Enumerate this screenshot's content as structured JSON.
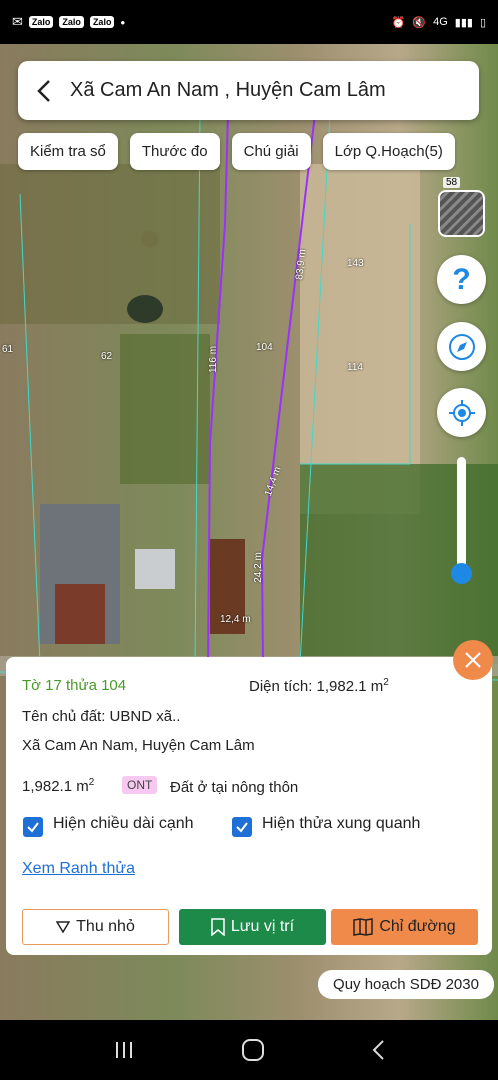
{
  "status": {
    "left_chips": [
      "Zalo",
      "Zalo",
      "Zalo"
    ],
    "network": "4G"
  },
  "header": {
    "title": "Xã Cam An Nam , Huyện Cam Lâm"
  },
  "toolbar": {
    "chips": [
      "Kiểm tra sổ",
      "Thước đo",
      "Chú giải",
      "Lớp Q.Hoạch(5)"
    ]
  },
  "map": {
    "side_badge": "58",
    "parcel_labels": [
      "143",
      "104",
      "114",
      "62",
      "61"
    ],
    "edge_labels": [
      "83,9 m",
      "116 m",
      "14,4 m",
      "24,2 m",
      "12,4 m"
    ],
    "selected_outline_color": "#9b30ff",
    "boundary_color": "#46d7c8"
  },
  "card": {
    "parcel": "Tờ 17 thửa 104",
    "area_label": "Diện tích: 1,982.1 m",
    "area_sup": "2",
    "owner": "Tên chủ đất: UBND xã..",
    "location": "Xã Cam An Nam, Huyện Cam Lâm",
    "area_value": "1,982.1 m",
    "area_value_sup": "2",
    "land_code": "ONT",
    "land_use": "Đất ở tại nông thôn",
    "check_edge_label": "Hiện chiều dài cạnh",
    "check_neighbors_label": "Hiện thửa xung quanh",
    "link_label": "Xem Ranh thửa",
    "btn_shrink": "Thu nhỏ",
    "btn_save": "Lưu vị trí",
    "btn_route": "Chỉ đường"
  },
  "plan_pill": "Quy hoạch SDĐ 2030",
  "colors": {
    "accent_blue": "#1e6fd6",
    "green": "#1e8a4a",
    "orange": "#f08a4b"
  }
}
